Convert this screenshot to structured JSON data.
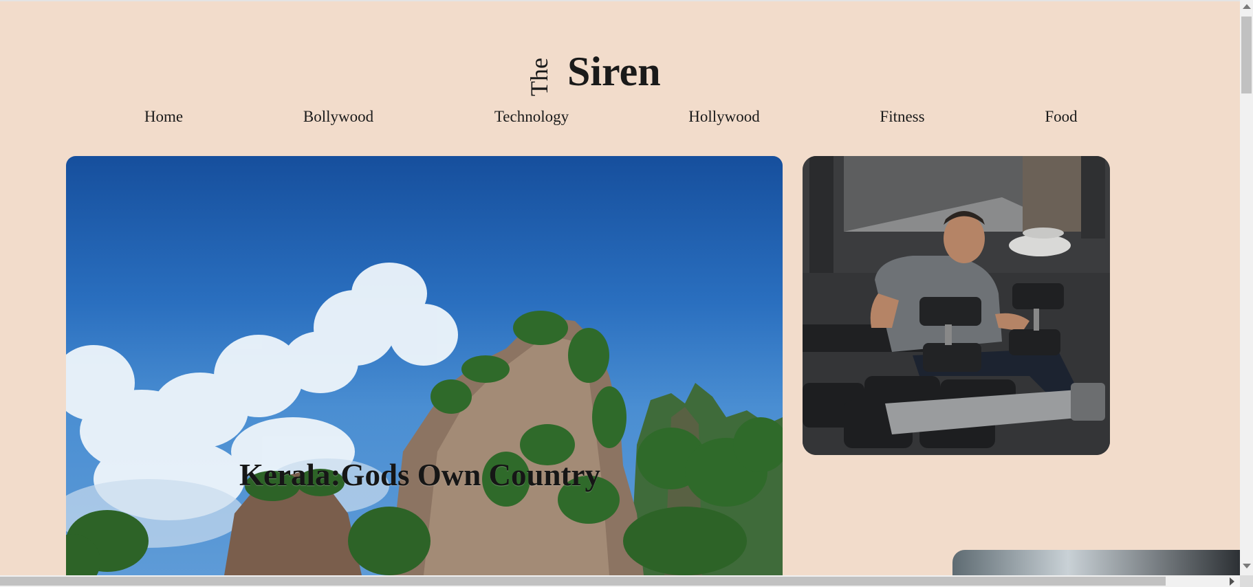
{
  "site": {
    "logo_small": "The",
    "logo_main": "Siren"
  },
  "nav": {
    "items": [
      {
        "label": "Home"
      },
      {
        "label": "Bollywood"
      },
      {
        "label": "Technology"
      },
      {
        "label": "Hollywood"
      },
      {
        "label": "Fitness"
      },
      {
        "label": "Food"
      }
    ]
  },
  "featured": {
    "title": "Kerala:Gods Own Country",
    "image": "tropical-cliffs-image"
  },
  "side_card": {
    "image": "dumbbell-workout-image"
  },
  "colors": {
    "background": "#f2dccb",
    "text": "#1a1a1a"
  }
}
